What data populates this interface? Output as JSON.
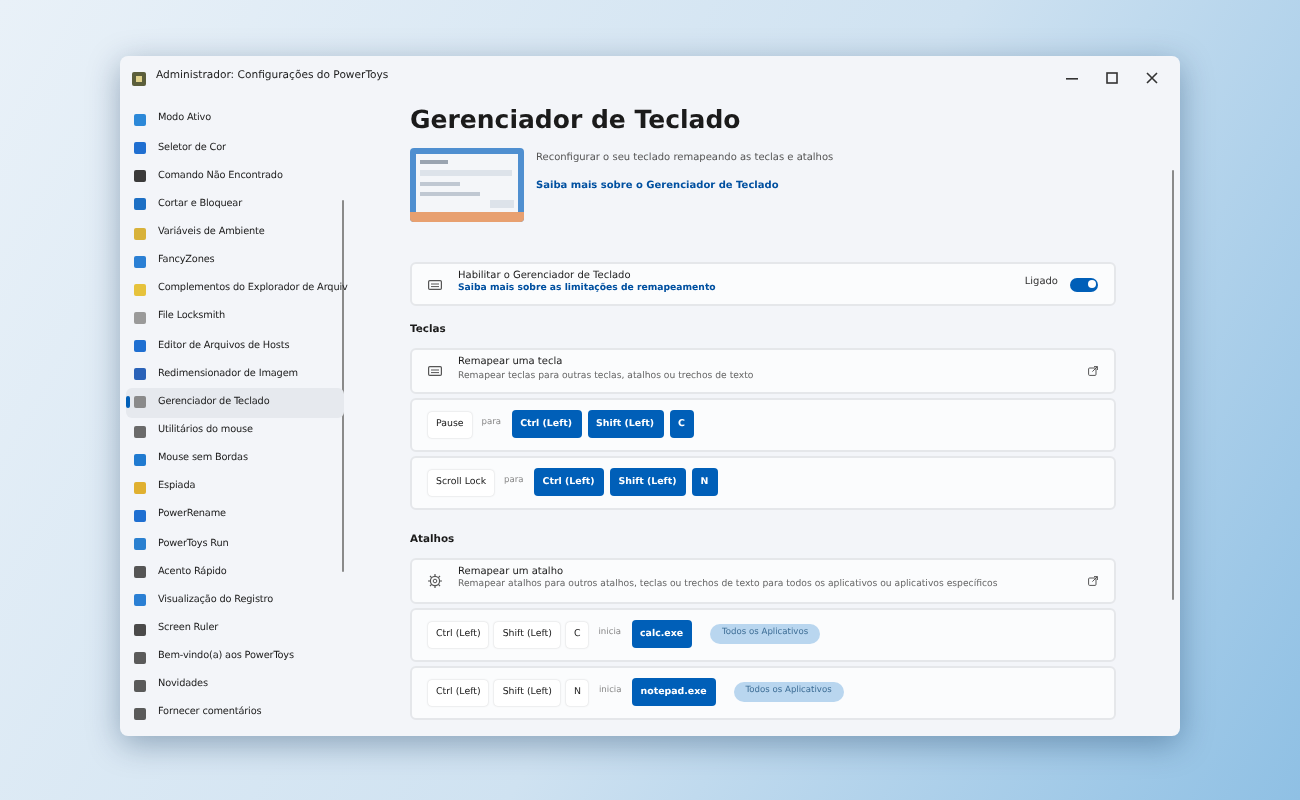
{
  "window": {
    "title": "Administrador: Configurações do PowerToys"
  },
  "sidebar": {
    "items": [
      {
        "label": "Modo Ativo",
        "selected": false,
        "color": "#2b88d8"
      },
      {
        "label": "Seletor de Cor",
        "selected": false,
        "color": "#1f6fd1"
      },
      {
        "label": "Comando Não Encontrado",
        "selected": false,
        "color": "#3a3a3a"
      },
      {
        "label": "Cortar e Bloquear",
        "selected": false,
        "color": "#1c6fc4"
      },
      {
        "label": "Variáveis de Ambiente",
        "selected": false,
        "color": "#d8b23a"
      },
      {
        "label": "FancyZones",
        "selected": false,
        "color": "#2a7fd4"
      },
      {
        "label": "Complementos do Explorador de Arquiv",
        "selected": false,
        "color": "#e6c23c"
      },
      {
        "label": "File Locksmith",
        "selected": false,
        "color": "#9a9a9a"
      },
      {
        "label": "Editor de Arquivos de Hosts",
        "selected": false,
        "color": "#1f6fd1"
      },
      {
        "label": "Redimensionador de Imagem",
        "selected": false,
        "color": "#2a62b8"
      },
      {
        "label": "Gerenciador de Teclado",
        "selected": true,
        "color": "#8a8a8a"
      },
      {
        "label": "Utilitários do mouse",
        "selected": false,
        "color": "#6a6a6a"
      },
      {
        "label": "Mouse sem Bordas",
        "selected": false,
        "color": "#1f7ad0"
      },
      {
        "label": "Espiada",
        "selected": false,
        "color": "#e0b030"
      },
      {
        "label": "PowerRename",
        "selected": false,
        "color": "#1f6fd1"
      },
      {
        "label": "PowerToys Run",
        "selected": false,
        "color": "#2a80d0"
      },
      {
        "label": "Acento Rápido",
        "selected": false,
        "color": "#555555"
      },
      {
        "label": "Visualização do Registro",
        "selected": false,
        "color": "#2a7fd4"
      },
      {
        "label": "Screen Ruler",
        "selected": false,
        "color": "#4a4a4a"
      },
      {
        "label": "Bem-vindo(a) aos PowerToys",
        "selected": false,
        "color": "#5a5a5a"
      },
      {
        "label": "Novidades",
        "selected": false,
        "color": "#5a5a5a"
      },
      {
        "label": "Fornecer comentários",
        "selected": false,
        "color": "#5a5a5a"
      }
    ]
  },
  "page": {
    "title": "Gerenciador de Teclado",
    "description": "Reconfigurar o seu teclado remapeando as teclas e atalhos",
    "link": "Saiba mais sobre o Gerenciador de Teclado",
    "enable": {
      "title": "Habilitar o Gerenciador de Teclado",
      "link": "Saiba mais sobre as limitações de remapeamento",
      "state_label": "Ligado",
      "on": true
    },
    "sections": [
      {
        "heading": "Teclas",
        "card": {
          "kind": "keyboard",
          "title": "Remapear uma tecla",
          "subtitle": "Remapear teclas para outras teclas, atalhos ou trechos de texto"
        },
        "rows": [
          {
            "from": [
              "Pause"
            ],
            "connector": "para",
            "to": [
              "Ctrl (Left)",
              "Shift (Left)",
              "C"
            ]
          },
          {
            "from": [
              "Scroll Lock"
            ],
            "connector": "para",
            "to": [
              "Ctrl (Left)",
              "Shift (Left)",
              "N"
            ]
          }
        ]
      },
      {
        "heading": "Atalhos",
        "card": {
          "kind": "gear",
          "title": "Remapear um atalho",
          "subtitle": "Remapear atalhos para outros atalhos, teclas ou trechos de texto para todos os aplicativos ou aplicativos específicos"
        },
        "rows": [
          {
            "from": [
              "Ctrl (Left)",
              "Shift (Left)",
              "C"
            ],
            "connector": "inicia",
            "to": [
              "calc.exe"
            ],
            "scope": "Todos os Aplicativos"
          },
          {
            "from": [
              "Ctrl (Left)",
              "Shift (Left)",
              "N"
            ],
            "connector": "inicia",
            "to": [
              "notepad.exe"
            ],
            "scope": "Todos os Aplicativos"
          }
        ]
      }
    ]
  }
}
